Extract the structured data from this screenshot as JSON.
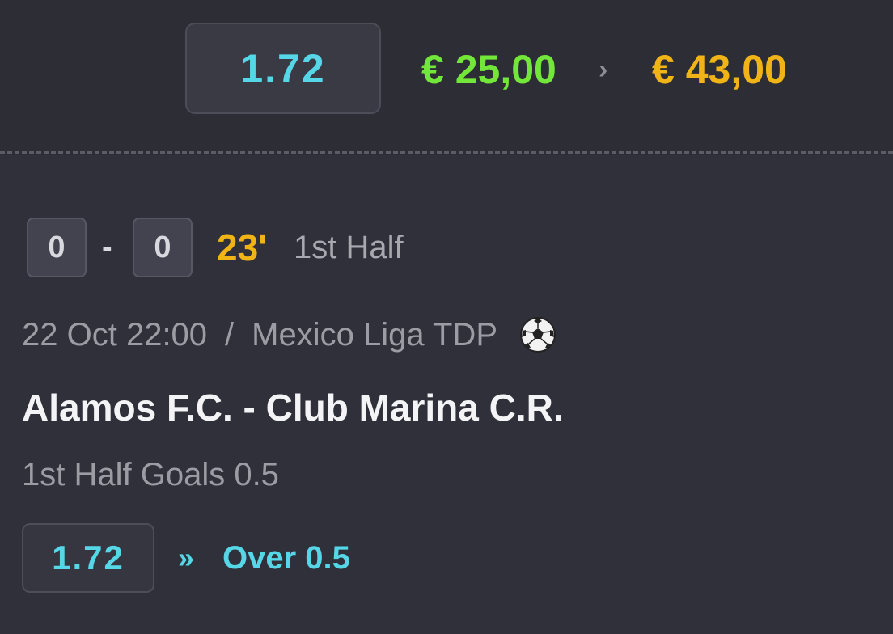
{
  "summary": {
    "odds": "1.72",
    "stake": "€ 25,00",
    "arrow": "›",
    "payout": "€ 43,00"
  },
  "live": {
    "home_score": "0",
    "separator": "-",
    "away_score": "0",
    "minute": "23'",
    "period": "1st Half"
  },
  "event": {
    "datetime": "22 Oct 22:00",
    "slash": "/",
    "league": "Mexico Liga TDP",
    "sport_icon": "soccer-ball-icon",
    "match": "Alamos F.C. - Club Marina C.R."
  },
  "selection": {
    "market": "1st Half Goals 0.5",
    "odds": "1.72",
    "arrow": "»",
    "pick": "Over 0.5"
  },
  "colors": {
    "odds": "#56d7e8",
    "stake": "#73e63a",
    "payout": "#f1b417",
    "minute": "#f1b417",
    "background": "#2d2d36"
  }
}
